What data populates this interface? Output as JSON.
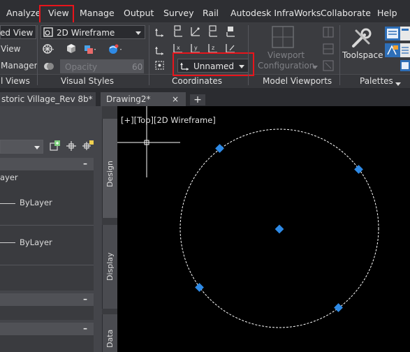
{
  "menu": {
    "items": [
      "Analyze",
      "View",
      "Manage",
      "Output",
      "Survey",
      "Rail",
      "Autodesk InfraWorks",
      "Collaborate",
      "Help"
    ],
    "active": "View"
  },
  "ribbon": {
    "views": {
      "named_view_dropdown": "ed View",
      "view_label": "View",
      "manager_label": "Manager",
      "panel_title": "l Views"
    },
    "visual_styles": {
      "style_dropdown": "2D Wireframe",
      "opacity_label": "Opacity",
      "opacity_value": "60",
      "panel_title": "Visual Styles"
    },
    "coordinates": {
      "ucs_dropdown": "Unnamed",
      "panel_title": "Coordinates"
    },
    "model_viewports": {
      "viewport_config_label": "Viewport",
      "viewport_config_label2": "Configuration",
      "panel_title": "Model Viewports"
    },
    "palettes": {
      "toolspace_label": "Toolspace",
      "panel_title": "Palettes"
    },
    "colors": {
      "highlight": "#e8141b",
      "accent_blue": "#2e8ae6"
    }
  },
  "tabs": {
    "items": [
      "storic Village_Rev 8b*",
      "Drawing2*"
    ],
    "close_glyph": "×",
    "new_tab_glyph": "+"
  },
  "palette": {
    "layer_text": "ayer",
    "bylayer_1": "ByLayer",
    "bylayer_2": "ByLayer",
    "section_glyph": "–",
    "side_tabs": [
      "Design",
      "Display",
      "Data"
    ]
  },
  "viewport": {
    "label": "[+][Top][2D Wireframe]"
  }
}
